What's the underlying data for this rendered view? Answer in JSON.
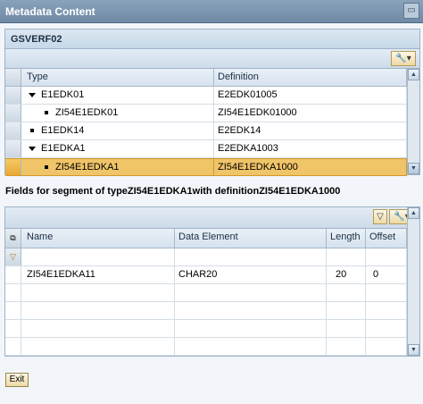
{
  "window": {
    "title": "Metadata Content",
    "close_icon": "close-icon"
  },
  "panel": {
    "title": "GSVERF02"
  },
  "tree_table": {
    "columns": [
      "Type",
      "Definition"
    ],
    "rows": [
      {
        "type": "E1EDK01",
        "definition": "E2EDK01005",
        "marker": "expanded"
      },
      {
        "type": "ZI54E1EDK01",
        "definition": "ZI54E1EDK01000",
        "marker": "leaf"
      },
      {
        "type": "E1EDK14",
        "definition": "E2EDK14",
        "marker": "leaf"
      },
      {
        "type": "E1EDKA1",
        "definition": "E2EDKA1003",
        "marker": "expanded"
      },
      {
        "type": "ZI54E1EDKA1",
        "definition": "ZI54E1EDKA1000",
        "marker": "leaf",
        "selected": true
      }
    ]
  },
  "segment_info": "Fields for segment of typeZI54E1EDKA1with definitionZI54E1EDKA1000",
  "fields_table": {
    "columns": [
      "Name",
      "Data Element",
      "Length",
      "Offset"
    ],
    "rows": [
      {
        "name": "ZI54E1EDKA11",
        "data_element": "CHAR20",
        "length": "20",
        "offset": "0"
      }
    ]
  },
  "buttons": {
    "exit": "Exit"
  },
  "colors": {
    "selected_row": "#f0c468",
    "header_bg": "#d6e2ee",
    "title_bar": "#7892ad"
  }
}
